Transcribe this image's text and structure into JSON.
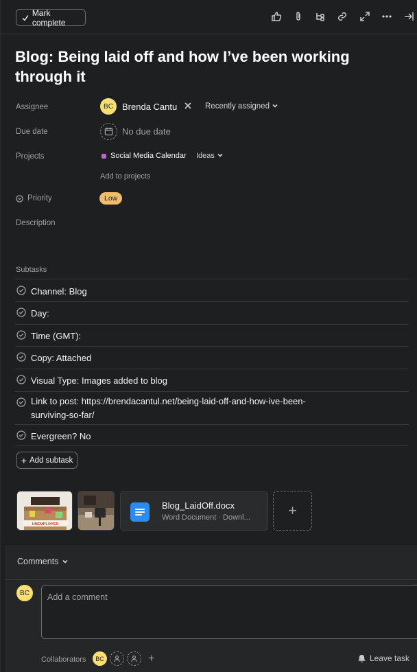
{
  "toolbar": {
    "mark_complete": "Mark complete",
    "icons": [
      "thumbs-up-icon",
      "attachment-icon",
      "subtask-icon",
      "link-icon",
      "expand-icon",
      "more-icon",
      "close-panel-icon"
    ]
  },
  "task": {
    "title": "Blog: Being laid off and how I’ve been working through it"
  },
  "fields": {
    "assignee_label": "Assignee",
    "assignee_initials": "BC",
    "assignee_name": "Brenda Cantu",
    "recently_assigned": "Recently assigned",
    "due_label": "Due date",
    "due_value": "No due date",
    "projects_label": "Projects",
    "project_name": "Social Media Calendar",
    "project_section": "Ideas",
    "add_to_projects": "Add to projects",
    "priority_label": "Priority",
    "priority_value": "Low",
    "description_label": "Description"
  },
  "subtasks": {
    "label": "Subtasks",
    "items": [
      "Channel: Blog",
      "Day:",
      "Time (GMT):",
      "Copy: Attached",
      "Visual Type: Images added to blog",
      "Link to post: https://brendacantul.net/being-laid-off-and-how-ive-been-surviving-so-far/",
      "Evergreen? No"
    ],
    "add_label": "Add subtask"
  },
  "attachments": {
    "image1_text": "UNEMPLOYED",
    "doc_name": "Blog_LaidOff.docx",
    "doc_sub": "Word Document · Downl..."
  },
  "comments": {
    "heading": "Comments",
    "placeholder": "Add a comment",
    "avatar_initials": "BC",
    "collaborators_label": "Collaborators",
    "leave_task": "Leave task"
  },
  "colors": {
    "background": "#1e1f21",
    "avatar": "#f8df72",
    "priority_low": "#f1bd6c",
    "project_dot": "#b36bd4",
    "doc_icon": "#2a8cf0"
  }
}
